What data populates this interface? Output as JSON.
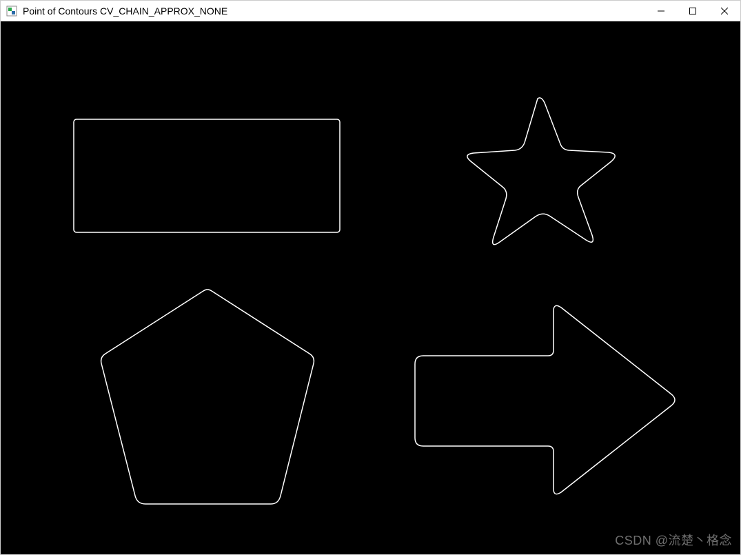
{
  "window": {
    "title": "Point of Contours CV_CHAIN_APPROX_NONE"
  },
  "controls": {
    "minimize": "minimize",
    "maximize": "maximize",
    "close": "close"
  },
  "watermark": {
    "text": "CSDN @流楚丶格念"
  },
  "shapes": {
    "rectangle_name": "rectangle-contour",
    "star_name": "star-contour",
    "pentagon_name": "pentagon-contour",
    "arrow_name": "arrow-contour"
  }
}
